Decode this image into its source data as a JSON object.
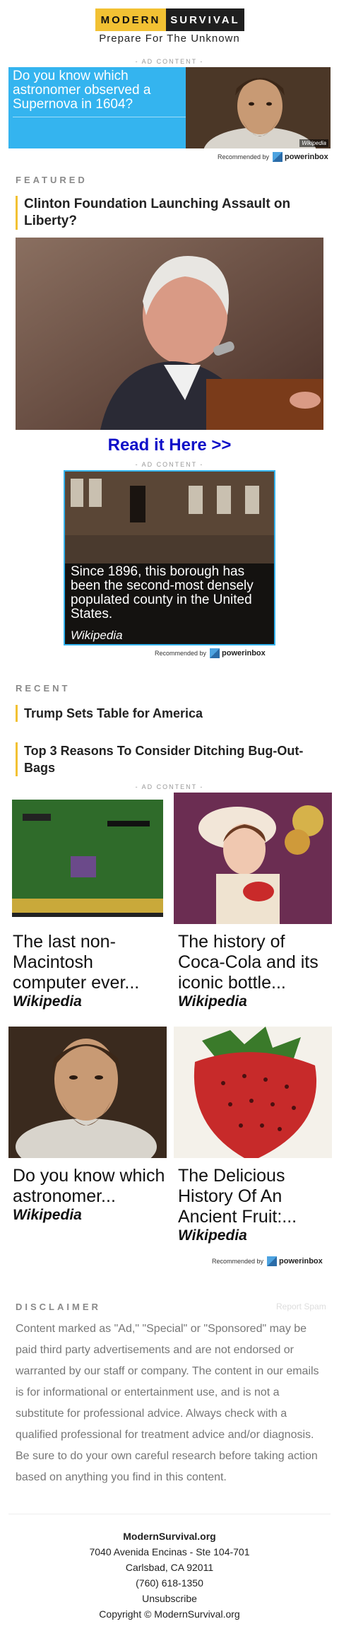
{
  "header": {
    "logo_left": "MODERN",
    "logo_right": "SURVIVAL",
    "tagline": "Prepare For The Unknown"
  },
  "ads": {
    "label": "- AD CONTENT -",
    "recommended_by": "Recommended by",
    "brand": "powerinbox",
    "ad1": {
      "text": "Do you know which astronomer observed a Supernova in 1604?",
      "source": "Wikipedia"
    },
    "ad2": {
      "text": "Since 1896, this borough has been the second-most densely populated county in the United States.",
      "source": "Wikipedia"
    }
  },
  "featured": {
    "label": "FEATURED",
    "headline": "Clinton Foundation Launching Assault on Liberty?",
    "cta": "Read it Here >>"
  },
  "recent": {
    "label": "RECENT",
    "items": [
      "Trump Sets Table for America",
      "Top 3 Reasons To Consider Ditching Bug-Out-Bags"
    ]
  },
  "grid": [
    {
      "caption": "The last non-Macintosh computer ever...",
      "source": "Wikipedia"
    },
    {
      "caption": "The history of Coca-Cola and its iconic bottle...",
      "source": "Wikipedia"
    },
    {
      "caption": "Do you know which astronomer...",
      "source": "Wikipedia"
    },
    {
      "caption": "The Delicious History Of An Ancient Fruit:...",
      "source": "Wikipedia"
    }
  ],
  "disclaimer": {
    "label": "DISCLAIMER",
    "report_spam": "Report Spam",
    "text": "Content marked as \"Ad,\" \"Special\" or \"Sponsored\" may be paid third party advertisements and are not endorsed or warranted by our staff or company. The content in our emails is for informational or entertainment use, and is not a substitute for professional advice. Always check with a qualified professional for treatment advice and/or diagnosis. Be sure to do your own careful research before taking action based on anything you find in this content."
  },
  "footer": {
    "org": "ModernSurvival.org",
    "address1": "7040 Avenida Encinas - Ste 104-701",
    "address2": "Carlsbad, CA 92011",
    "phone": "(760) 618-1350",
    "unsubscribe": "Unsubscribe",
    "copyright": "Copyright © ModernSurvival.org"
  },
  "colors": {
    "accent": "#f2c133",
    "ad_blue": "#34b4ef",
    "link": "#1010c8"
  }
}
